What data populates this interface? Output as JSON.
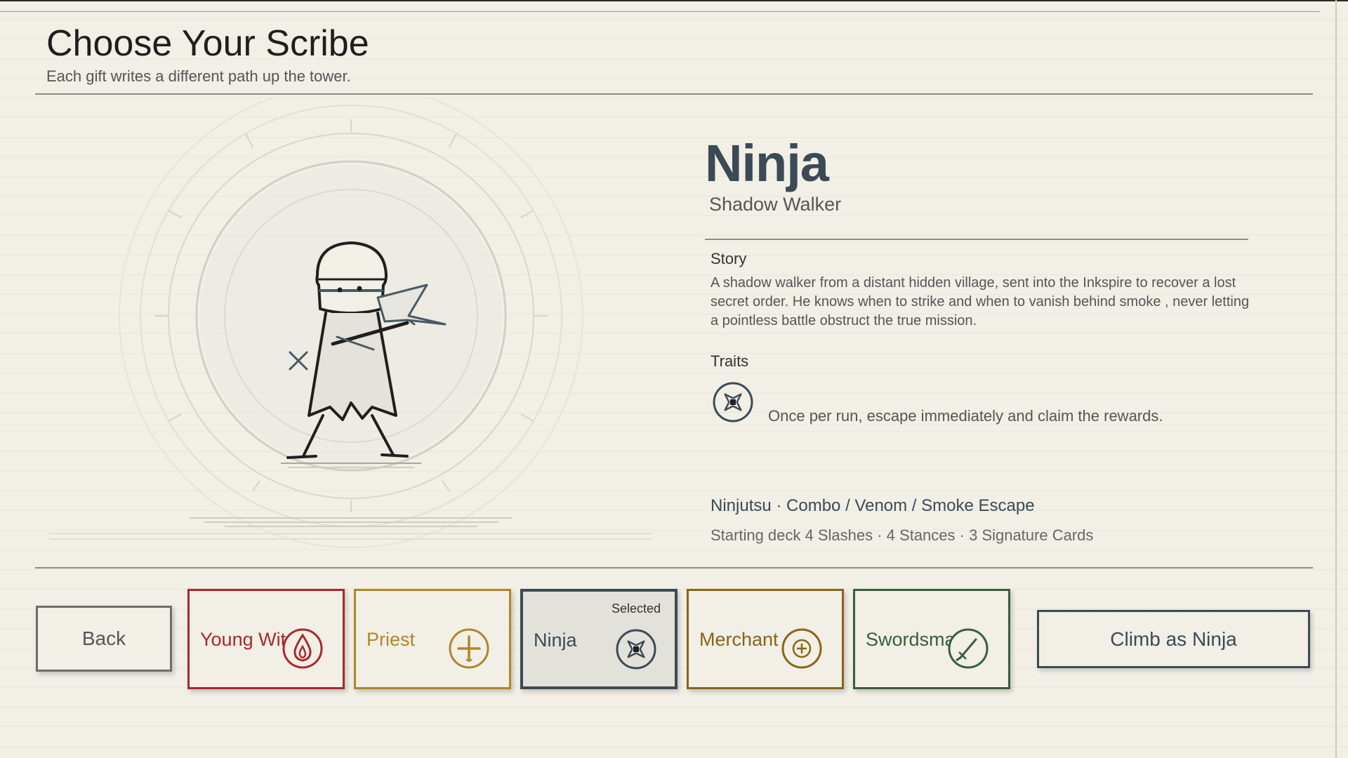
{
  "header": {
    "title": "Choose Your Scribe",
    "subtitle": "Each gift writes a different path up the tower."
  },
  "character": {
    "name": "Ninja",
    "epithet": "Shadow Walker",
    "story_label": "Story",
    "story": "A shadow walker from a distant hidden village, sent into the Inkspire to recover a lost secret order. He knows when to strike and when to vanish behind smoke , never letting a pointless battle obstruct the true mission.",
    "traits_label": "Traits",
    "trait_icon": "shuriken-icon",
    "trait_text": "Once per run, escape immediately and claim the rewards.",
    "play_style": "Ninjutsu · Combo / Venom / Smoke Escape",
    "starting_deck": "Starting deck  4 Slashes · 4 Stances · 3 Signature Cards"
  },
  "footer": {
    "back_label": "Back",
    "cards": [
      {
        "name": "Young Witch",
        "icon": "flame-icon",
        "color": "#a8282c"
      },
      {
        "name": "Priest",
        "icon": "cross-icon",
        "color": "#b0862a"
      },
      {
        "name": "Ninja",
        "icon": "shuriken-icon",
        "color": "#3b4a55",
        "selected_label": "Selected"
      },
      {
        "name": "Merchant",
        "icon": "coin-icon",
        "color": "#8a6418"
      },
      {
        "name": "Swordsman",
        "icon": "sword-icon",
        "color": "#3a5e3c"
      }
    ],
    "confirm_label": "Climb as Ninja"
  },
  "colors": {
    "background": "#f1efe6",
    "accent": "#3b4a55",
    "ink": "#2a2a2a"
  }
}
